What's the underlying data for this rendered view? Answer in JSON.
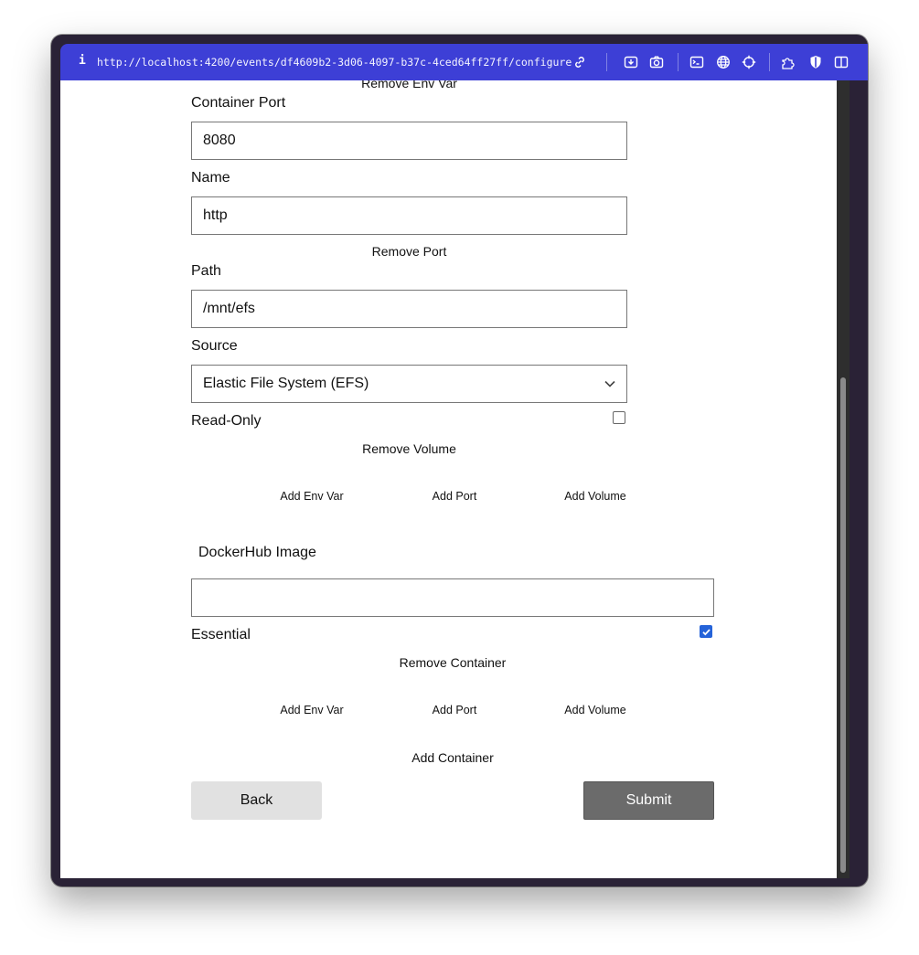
{
  "browser": {
    "info_glyph": "i",
    "url": "http://localhost:4200/events/df4609b2-3d06-4097-b37c-4ced64ff27ff/configure",
    "toolbar_icons": [
      "link-icon",
      "download-icon",
      "camera-icon",
      "terminal-icon",
      "globe-icon",
      "crosshair-icon",
      "extension-icon",
      "shield-icon",
      "sidebar-icon"
    ]
  },
  "port_section": {
    "remove_env_var_label": "Remove Env Var",
    "container_port_label": "Container Port",
    "container_port_value": "8080",
    "name_label": "Name",
    "name_value": "http",
    "remove_port_label": "Remove Port"
  },
  "volume_section": {
    "path_label": "Path",
    "path_value": "/mnt/efs",
    "source_label": "Source",
    "source_selected": "Elastic File System (EFS)",
    "read_only_label": "Read-Only",
    "read_only_checked": false,
    "remove_volume_label": "Remove Volume"
  },
  "container_actions_1": {
    "add_env_var": "Add Env Var",
    "add_port": "Add Port",
    "add_volume": "Add Volume"
  },
  "container_2": {
    "dockerhub_label": "DockerHub Image",
    "dockerhub_value": "",
    "essential_label": "Essential",
    "essential_checked": true,
    "remove_container_label": "Remove Container"
  },
  "container_actions_2": {
    "add_env_var": "Add Env Var",
    "add_port": "Add Port",
    "add_volume": "Add Volume"
  },
  "footer": {
    "add_container_label": "Add Container",
    "back_label": "Back",
    "submit_label": "Submit"
  },
  "colors": {
    "toolbar": "#3d3fd6",
    "checkbox_checked": "#2563d9",
    "submit_bg": "#6b6b6b",
    "back_bg": "#e1e1e1"
  }
}
